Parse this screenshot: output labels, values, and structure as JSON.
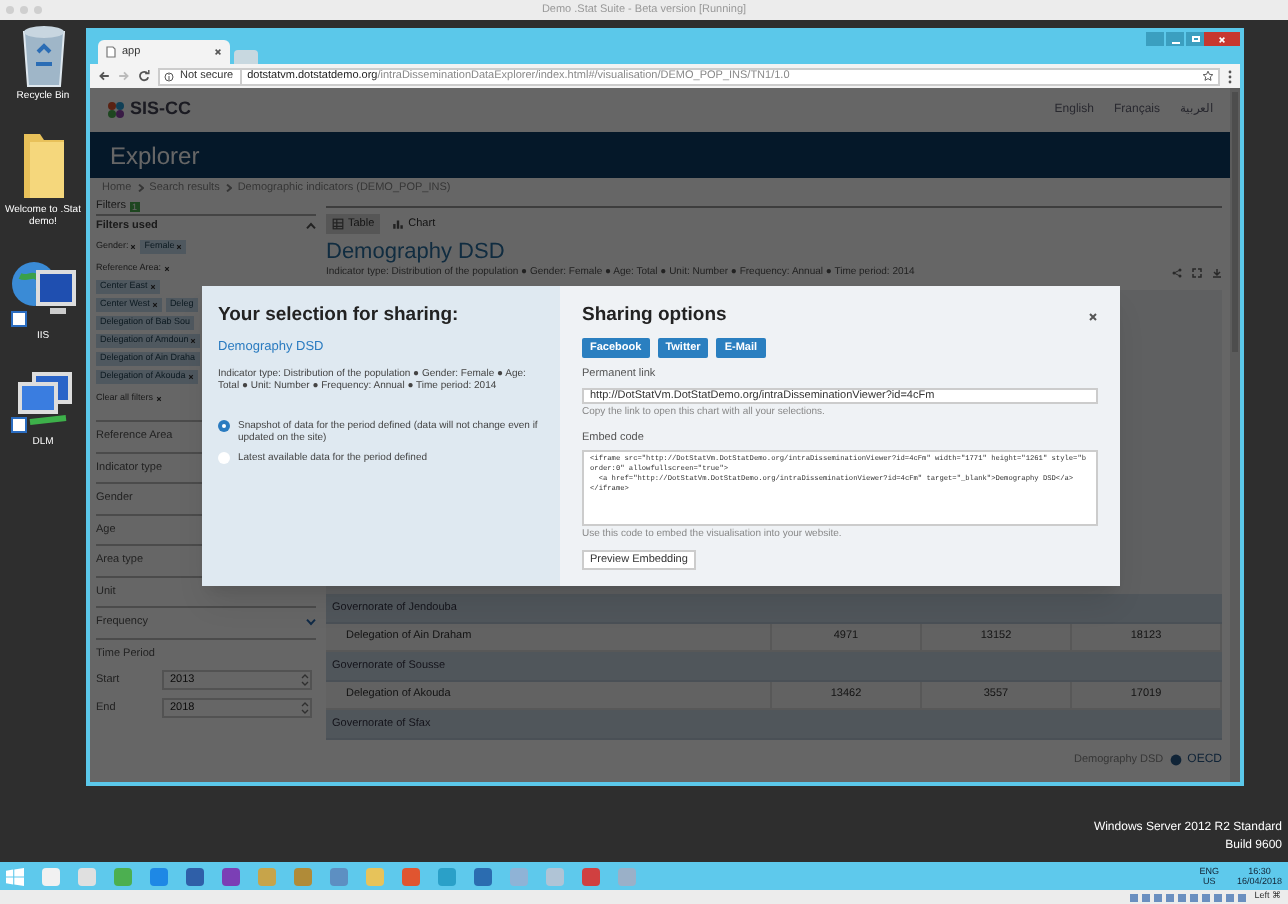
{
  "host_window": {
    "title": "Demo .Stat Suite - Beta version [Running]"
  },
  "desktop_icons": [
    {
      "label": "Recycle Bin",
      "kind": "bin"
    },
    {
      "label": "Welcome to .Stat demo!",
      "kind": "folder"
    },
    {
      "label": "IIS",
      "kind": "globe"
    },
    {
      "label": "DLM",
      "kind": "network"
    }
  ],
  "browser": {
    "tab": {
      "title": "app"
    },
    "address_bar": {
      "security": "Not secure",
      "host": "dotstatvm.dotstatdemo.org",
      "path": "/intraDisseminationDataExplorer/index.html#/visualisation/DEMO_POP_INS/TN1/1.0"
    }
  },
  "page": {
    "logo_text": "SIS-CC",
    "languages": [
      "English",
      "Français",
      "العربية"
    ],
    "banner": "Explorer",
    "breadcrumb": [
      "Home",
      "Search results",
      "Demographic indicators (DEMO_POP_INS)"
    ],
    "filters": {
      "title": "Filters",
      "count": "1",
      "used_title": "Filters used",
      "used": [
        {
          "label": "Gender:",
          "chips": [
            {
              "text": "Female",
              "removable": true
            }
          ]
        },
        {
          "label": "Reference Area:",
          "chips": [
            {
              "text": "Center East",
              "removable": true
            },
            {
              "text": "Center West",
              "removable": true
            },
            {
              "text": "Deleg",
              "removable": false
            },
            {
              "text": "Delegation of Bab Sou",
              "removable": false
            },
            {
              "text": "Delegation of Amdoun",
              "removable": true
            },
            {
              "text": "Delegation of Ain Draha",
              "removable": false
            },
            {
              "text": "Delegation of Akouda",
              "removable": true
            }
          ]
        }
      ],
      "clear": "Clear all filters",
      "sections": [
        {
          "label": "Reference Area",
          "kind": "heading"
        },
        {
          "label": "Indicator type",
          "kind": "heading"
        },
        {
          "label": "Gender",
          "kind": "heading"
        },
        {
          "label": "Age",
          "kind": "heading"
        },
        {
          "label": "Area type",
          "kind": "heading"
        },
        {
          "label": "Unit",
          "kind": "heading"
        },
        {
          "label": "Frequency",
          "kind": "dropdown"
        }
      ],
      "time_period": {
        "title": "Time Period",
        "fields": [
          {
            "label": "Start",
            "value": "2013"
          },
          {
            "label": "End",
            "value": "2018"
          }
        ]
      }
    },
    "view_tabs": [
      {
        "label": "Table",
        "kind": "table",
        "selected": true
      },
      {
        "label": "Chart",
        "kind": "chart",
        "selected": false
      }
    ],
    "title": "Demography DSD",
    "subtitle": "Indicator type: Distribution of the population ● Gender: Female ● Age: Total ● Unit: Number ● Frequency: Annual ● Time period: 2014",
    "table": {
      "rows": [
        {
          "kind": "group",
          "label": "Governorate of Jendouba"
        },
        {
          "kind": "data",
          "label": "Delegation of Ain Draham",
          "values": [
            "4971",
            "13152",
            "18123"
          ]
        },
        {
          "kind": "group",
          "label": "Governorate of Sousse"
        },
        {
          "kind": "data",
          "label": "Delegation of Akouda",
          "values": [
            "13462",
            "3557",
            "17019"
          ]
        },
        {
          "kind": "group",
          "label": "Governorate of Sfax"
        }
      ]
    },
    "footer": {
      "source": "Demography DSD",
      "logo_text": "OECD"
    }
  },
  "dialog": {
    "selection": {
      "title": "Your selection for sharing:",
      "link": "Demography DSD",
      "description": "Indicator type: Distribution of the population ● Gender: Female ● Age: Total ● Unit: Number ● Frequency: Annual ● Time period: 2014",
      "options": [
        {
          "label": "Snapshot of data for the period defined (data will not change even if updated on the site)",
          "selected": true
        },
        {
          "label": "Latest available data for the period defined",
          "selected": false
        }
      ]
    },
    "sharing": {
      "title": "Sharing options",
      "buttons": [
        "Facebook",
        "Twitter",
        "E-Mail"
      ],
      "permanent_link": {
        "label": "Permanent link",
        "value": "http://DotStatVm.DotStatDemo.org/intraDisseminationViewer?id=4cFm",
        "help": "Copy the link to open this chart with all your selections."
      },
      "embed_code": {
        "label": "Embed code",
        "value": "<iframe src=\"http://DotStatVm.DotStatDemo.org/intraDisseminationViewer?id=4cFm\" width=\"1771\" height=\"1261\" style=\"border:0\" allowfullscreen=\"true\">\n  <a href=\"http://DotStatVm.DotStatDemo.org/intraDisseminationViewer?id=4cFm\" target=\"_blank\">Demography DSD</a>\n</iframe>",
        "help": "Use this code to embed the visualisation into your website."
      },
      "preview_button": "Preview Embedding"
    }
  },
  "os": {
    "edition": "Windows Server 2012 R2 Standard",
    "build": "Build 9600",
    "tray": {
      "language": "ENG",
      "region": "US",
      "time": "16:30",
      "date": "16/04/2018"
    },
    "host_key": "Left ⌘"
  }
}
